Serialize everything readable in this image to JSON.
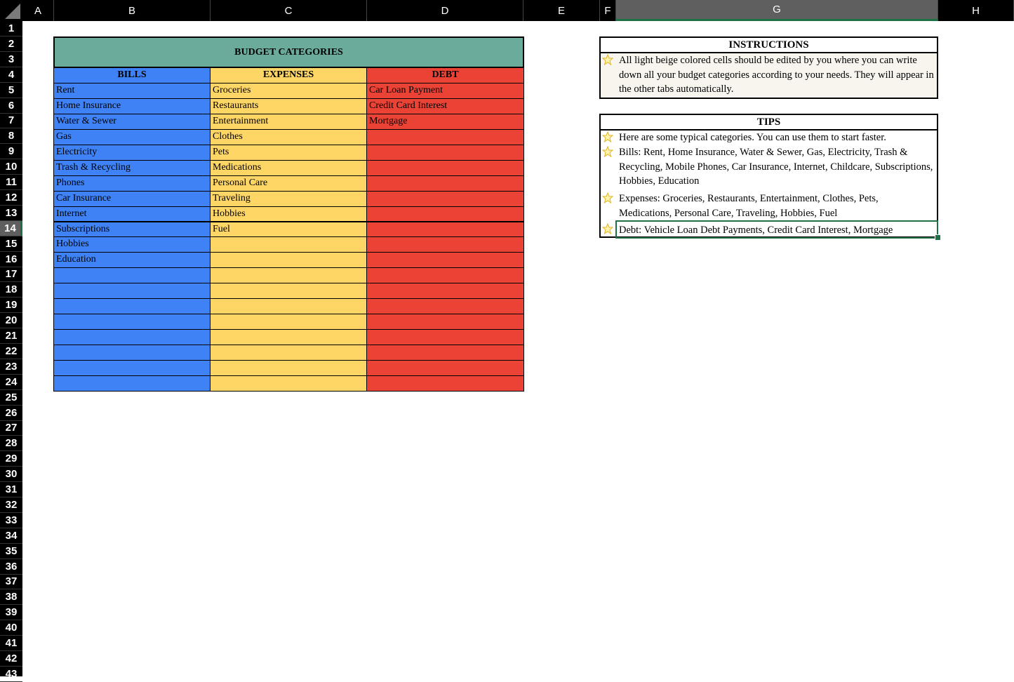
{
  "columns": [
    "A",
    "B",
    "C",
    "D",
    "E",
    "F",
    "G",
    "H"
  ],
  "selected_column": "G",
  "rows": [
    "1",
    "2",
    "3",
    "4",
    "5",
    "6",
    "7",
    "8",
    "9",
    "10",
    "11",
    "12",
    "13",
    "14",
    "15",
    "16",
    "17",
    "18",
    "19",
    "20",
    "21",
    "22",
    "23",
    "24",
    "25",
    "26",
    "27",
    "28",
    "29",
    "30",
    "31",
    "32",
    "33",
    "34",
    "35",
    "36",
    "37",
    "38",
    "39",
    "40",
    "41",
    "42",
    "43"
  ],
  "selected_row": "14",
  "budget": {
    "title": "BUDGET CATEGORIES",
    "headers": [
      "BILLS",
      "EXPENSES",
      "DEBT"
    ],
    "bills": [
      "Rent",
      "Home Insurance",
      "Water & Sewer",
      "Gas",
      "Electricity",
      "Trash & Recycling",
      "Phones",
      "Car Insurance",
      "Internet",
      "Subscriptions",
      "Hobbies",
      "Education",
      "",
      "",
      "",
      "",
      "",
      "",
      "",
      ""
    ],
    "expenses": [
      "Groceries",
      "Restaurants",
      "Entertainment",
      "Clothes",
      "Pets",
      "Medications",
      "Personal Care",
      "Traveling",
      "Hobbies",
      "Fuel",
      "",
      "",
      "",
      "",
      "",
      "",
      "",
      "",
      "",
      ""
    ],
    "debt": [
      "Car Loan Payment",
      "Credit Card Interest",
      "Mortgage",
      "",
      "",
      "",
      "",
      "",
      "",
      "",
      "",
      "",
      "",
      "",
      "",
      "",
      "",
      "",
      "",
      ""
    ]
  },
  "instructions": {
    "title": "INSTRUCTIONS",
    "lines": [
      "All light beige colored cells should be edited by you where you can write",
      "down all your budget categories according to your needs. They will appear in",
      "the other tabs automatically."
    ]
  },
  "tips": {
    "title": "TIPS",
    "items": [
      {
        "lines": [
          "Here are some typical categories. You can use them to start faster."
        ]
      },
      {
        "lines": [
          "Bills: Rent, Home Insurance, Water & Sewer, Gas, Electricity, Trash &",
          "Recycling, Mobile Phones, Car Insurance, Internet, Childcare, Subscriptions,",
          "Hobbies, Education"
        ]
      },
      {
        "lines": [
          "Expenses: Groceries, Restaurants, Entertainment, Clothes, Pets,",
          "Medications, Personal Care, Traveling, Hobbies, Fuel"
        ]
      },
      {
        "lines": [
          "Debt: Vehicle Loan Debt Payments, Credit Card Interest, Mortgage"
        ]
      }
    ]
  },
  "colors": {
    "bills": "#3e82f5",
    "expenses": "#fed666",
    "debt": "#ea4335",
    "title_band": "#6aab9c",
    "instructions_bg": "#f8f5ef",
    "selection": "#1e7145",
    "star": "#f4c430"
  },
  "icons": [
    "star-icon"
  ]
}
